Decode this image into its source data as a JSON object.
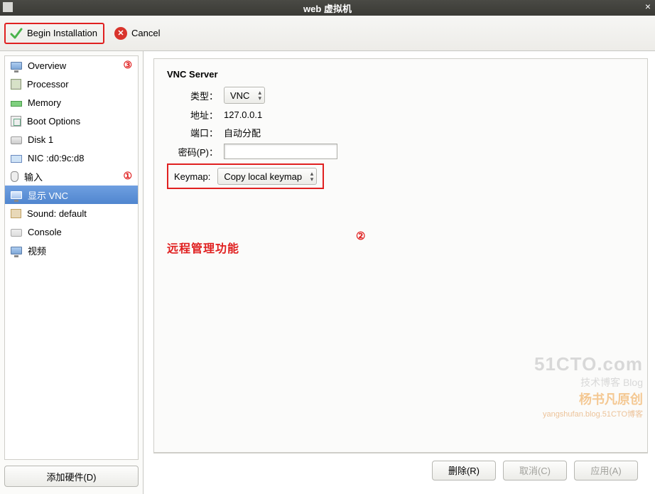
{
  "window": {
    "title": "web 虚拟机"
  },
  "toolbar": {
    "begin_label": "Begin Installation",
    "cancel_label": "Cancel"
  },
  "sidebar": {
    "items": [
      {
        "label": "Overview",
        "icon": "monitor-icon"
      },
      {
        "label": "Processor",
        "icon": "chip-icon"
      },
      {
        "label": "Memory",
        "icon": "memory-icon"
      },
      {
        "label": "Boot Options",
        "icon": "boot-icon"
      },
      {
        "label": "Disk 1",
        "icon": "disk-icon"
      },
      {
        "label": "NIC :d0:9c:d8",
        "icon": "nic-icon"
      },
      {
        "label": "输入",
        "icon": "mouse-icon"
      },
      {
        "label": "显示 VNC",
        "icon": "monitor-icon",
        "selected": true
      },
      {
        "label": "Sound: default",
        "icon": "sound-icon"
      },
      {
        "label": "Console",
        "icon": "console-icon"
      },
      {
        "label": "视频",
        "icon": "monitor-icon"
      }
    ],
    "add_hardware_label": "添加硬件(D)"
  },
  "annotations": {
    "n1": "①",
    "n2": "②",
    "n3": "③",
    "note": "远程管理功能"
  },
  "detail": {
    "title": "VNC Server",
    "type_label": "类型：",
    "type_value": "VNC",
    "addr_label": "地址：",
    "addr_value": "127.0.0.1",
    "port_label": "端口：",
    "port_value": "自动分配",
    "password_label": "密码(P)：",
    "password_value": "",
    "keymap_label": "Keymap:",
    "keymap_value": "Copy local keymap"
  },
  "footer": {
    "remove_label": "删除(R)",
    "cancel_label": "取消(C)",
    "apply_label": "应用(A)"
  },
  "watermark": {
    "l1": "51CTO.com",
    "l2": "技术博客    Blog",
    "l3": "杨书凡原创",
    "l4": "yangshufan.blog.51CTO博客"
  }
}
